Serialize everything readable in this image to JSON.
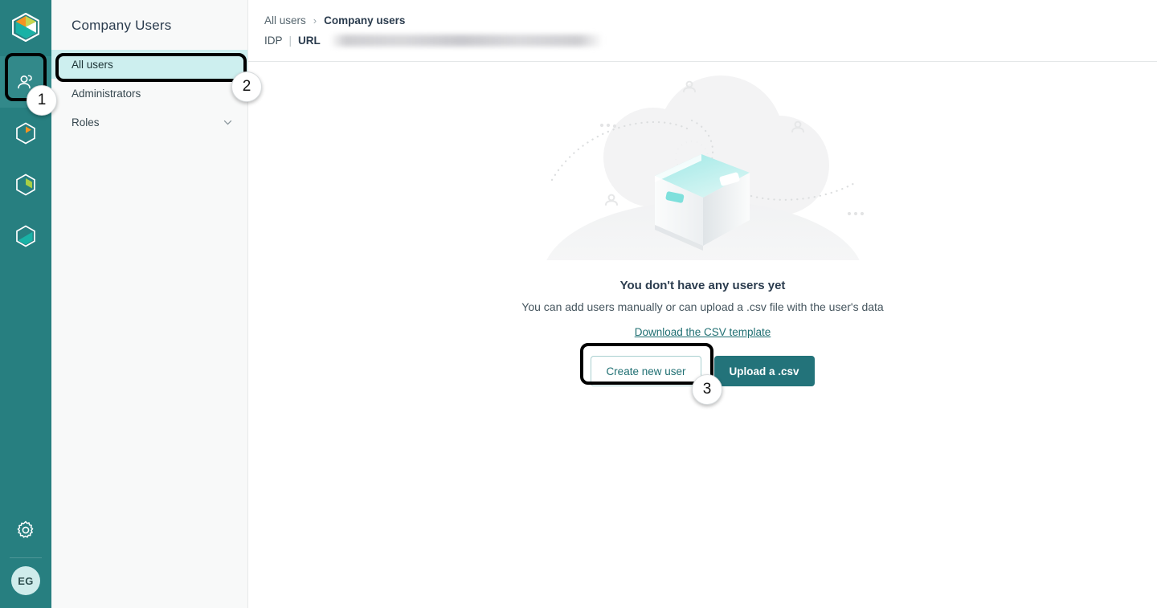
{
  "rail": {
    "logo_icon": "cube-logo-icon",
    "items": [
      {
        "icon": "users-icon",
        "name": "rail-item-users",
        "active": true
      },
      {
        "icon": "hexagon-orange-icon",
        "name": "rail-item-catalog",
        "active": false
      },
      {
        "icon": "hexagon-green-icon",
        "name": "rail-item-analytics",
        "active": false
      },
      {
        "icon": "hexagon-teal-icon",
        "name": "rail-item-integrations",
        "active": false
      }
    ],
    "settings_icon": "gear-icon",
    "avatar_initials": "EG"
  },
  "sidebar": {
    "title": "Company Users",
    "items": [
      {
        "label": "All users",
        "selected": true,
        "expandable": false
      },
      {
        "label": "Administrators",
        "selected": false,
        "expandable": false
      },
      {
        "label": "Roles",
        "selected": false,
        "expandable": true
      }
    ]
  },
  "breadcrumb": {
    "parent": "All users",
    "separator": "›",
    "current": "Company users"
  },
  "idp": {
    "label": "IDP",
    "pipe": "|",
    "url_label": "URL",
    "url_value": ""
  },
  "empty_state": {
    "illustration": "empty-box-illustration",
    "title": "You don't have any users yet",
    "subtitle": "You can add users manually or can upload a .csv file with the user's data",
    "link": "Download the CSV template",
    "primary_button": "Upload a .csv",
    "secondary_button": "Create new user"
  },
  "annotations": [
    {
      "number": "1",
      "target": "rail-item-users"
    },
    {
      "number": "2",
      "target": "sidebar-item-all-users"
    },
    {
      "number": "3",
      "target": "create-new-user-button"
    }
  ],
  "colors": {
    "rail_teal": "#277f80",
    "rail_active": "#32898a",
    "selected_nav": "#cdefef",
    "primary_button": "#23737a",
    "link_teal": "#1f6f72",
    "sidebar_bg": "#f8f9f9"
  }
}
